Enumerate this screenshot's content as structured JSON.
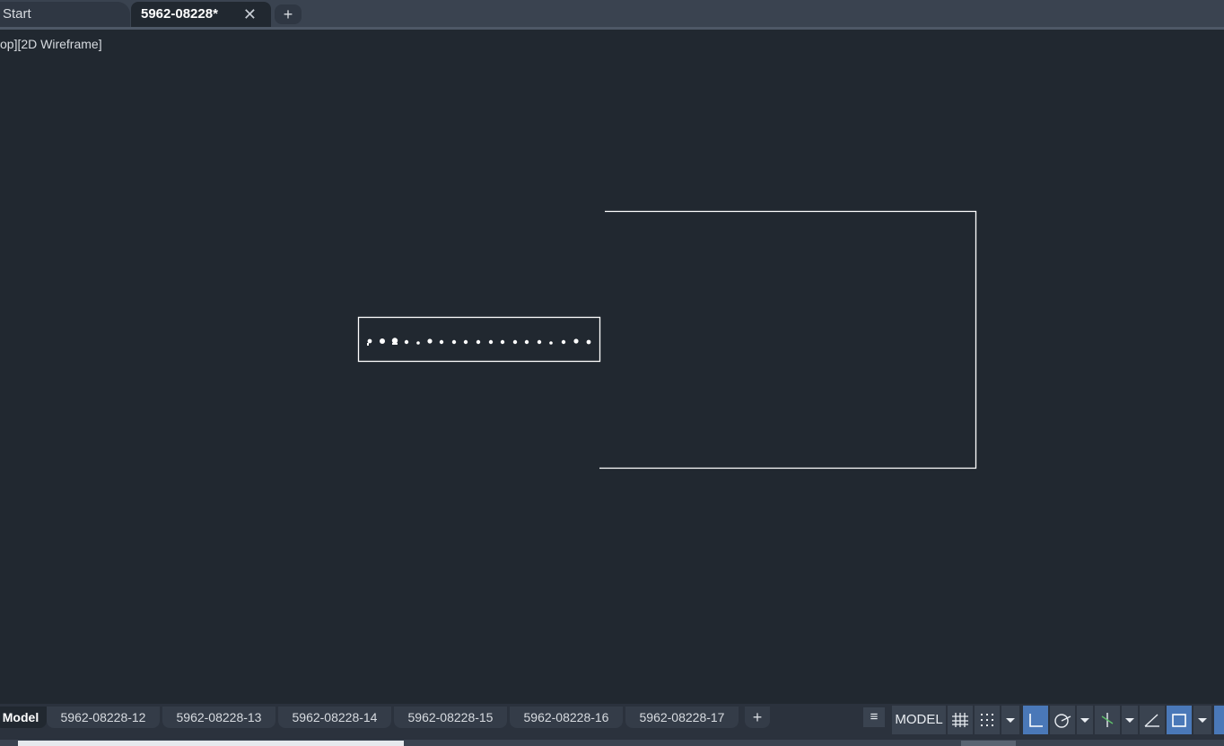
{
  "file_tabs": {
    "start_label": "Start",
    "active_label": "5962-08228*",
    "close_glyph": "✕",
    "new_tab_glyph": "+"
  },
  "viewport": {
    "label": "op][2D Wireframe]"
  },
  "layout_tabs": {
    "items": [
      "Model",
      "5962-08228-12",
      "5962-08228-13",
      "5962-08228-14",
      "5962-08228-15",
      "5962-08228-16",
      "5962-08228-17"
    ],
    "add_glyph": "+"
  },
  "status_bar": {
    "menu_glyph": "≡",
    "model_label": "MODEL",
    "icons": [
      "grid-icon",
      "snap-icon",
      "dropdown-icon",
      "ortho-icon",
      "polar-icon",
      "dropdown-icon",
      "osnap-icon",
      "dropdown-icon",
      "isodraft-icon",
      "dynucs-icon",
      "dropdown-icon"
    ]
  },
  "colors": {
    "canvas": "#212830",
    "tab_bar": "#3a4350",
    "accent": "#4a78b8",
    "line": "#ffffff"
  }
}
